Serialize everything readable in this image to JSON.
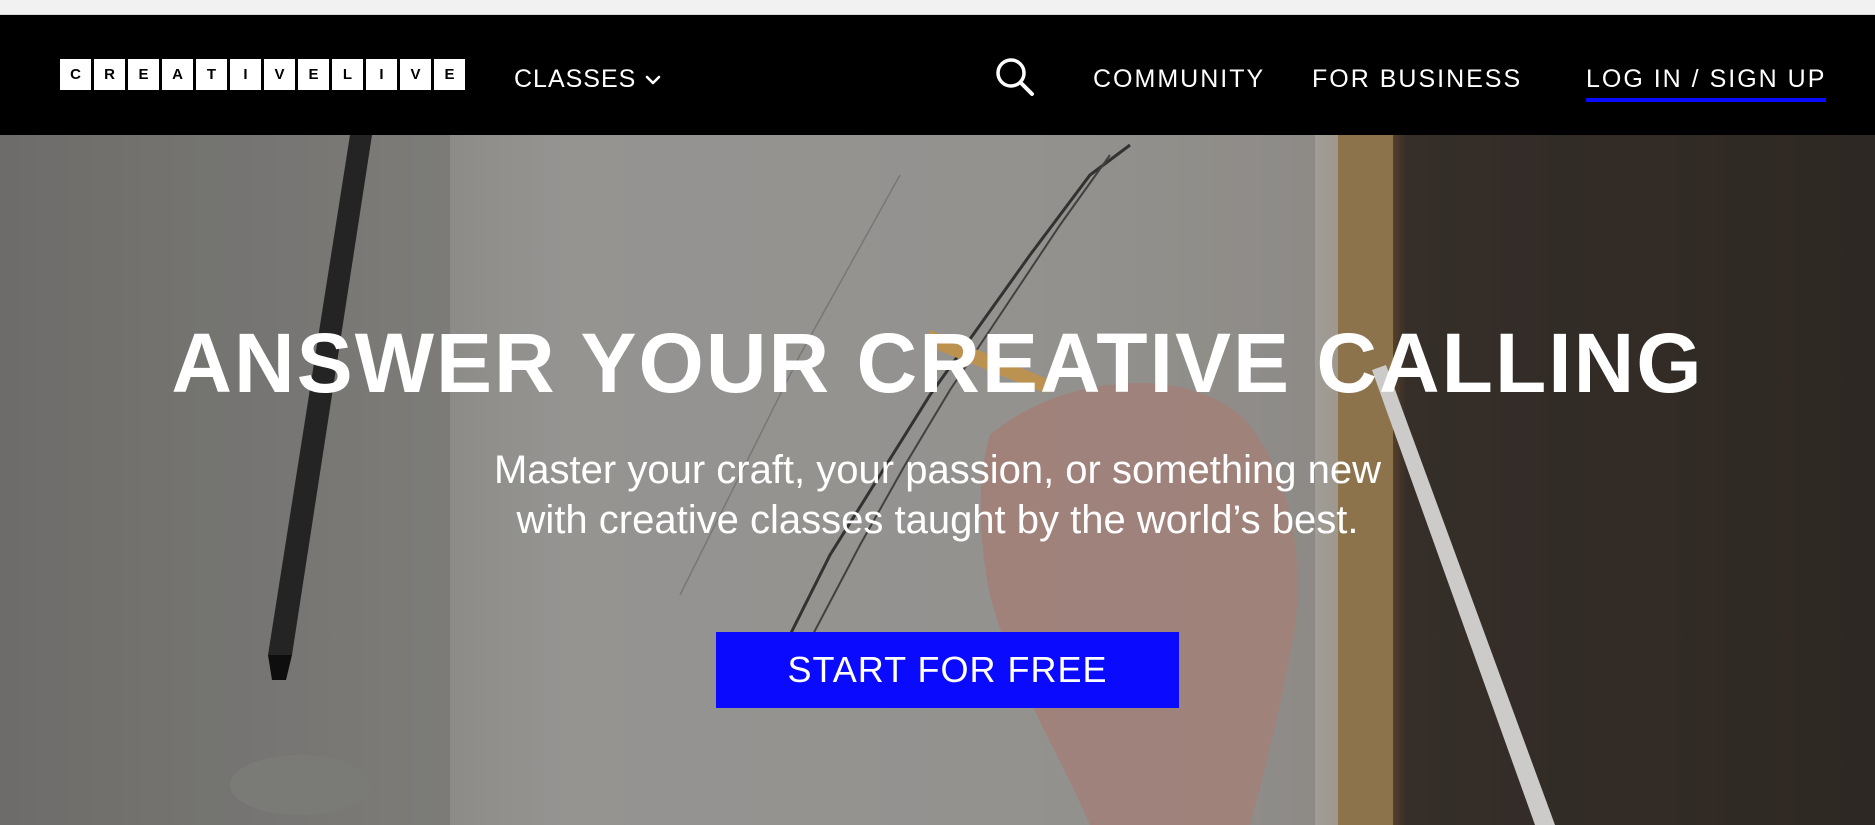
{
  "logo": {
    "letters": [
      "C",
      "R",
      "E",
      "A",
      "T",
      "I",
      "V",
      "E",
      "L",
      "I",
      "V",
      "E"
    ]
  },
  "nav": {
    "classes_label": "CLASSES",
    "community_label": "COMMUNITY",
    "business_label": "FOR BUSINESS",
    "login_label": "LOG IN / SIGN UP",
    "search_icon": "search-icon",
    "chevron_icon": "chevron-down-icon"
  },
  "hero": {
    "title": "ANSWER YOUR CREATIVE CALLING",
    "subtitle_line1": "Master your craft, your passion, or something new",
    "subtitle_line2": "with creative classes taught by the world’s best.",
    "cta_label": "START FOR FREE"
  },
  "colors": {
    "accent": "#0a0aff",
    "nav_bg": "#000000",
    "text": "#ffffff"
  }
}
